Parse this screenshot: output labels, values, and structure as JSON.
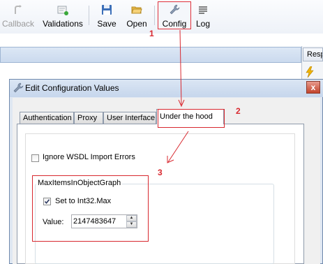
{
  "toolbar": {
    "callback_label": "Callback",
    "validations_label": "Validations",
    "save_label": "Save",
    "open_label": "Open",
    "config_label": "Config",
    "log_label": "Log"
  },
  "background": {
    "right_tab_label": "Resp"
  },
  "dialog": {
    "title": "Edit Configuration Values",
    "close_label": "x",
    "tabs": [
      {
        "label": "Authentication"
      },
      {
        "label": "Proxy"
      },
      {
        "label": "User Interface"
      },
      {
        "label": "Under the hood"
      }
    ],
    "ignore_wsdl_label": "Ignore WSDL Import Errors",
    "ignore_wsdl_checked": false,
    "group_title": "MaxItemsInObjectGraph",
    "set_int32_label": "Set to Int32.Max",
    "set_int32_checked": true,
    "value_label": "Value:",
    "value": "2147483647"
  },
  "annotations": {
    "step1": "1",
    "step2": "2",
    "step3": "3"
  },
  "colors": {
    "annotation_red": "#d8282f",
    "title_bar": "#c6d6ec",
    "header_bar": "#cbdaee"
  }
}
